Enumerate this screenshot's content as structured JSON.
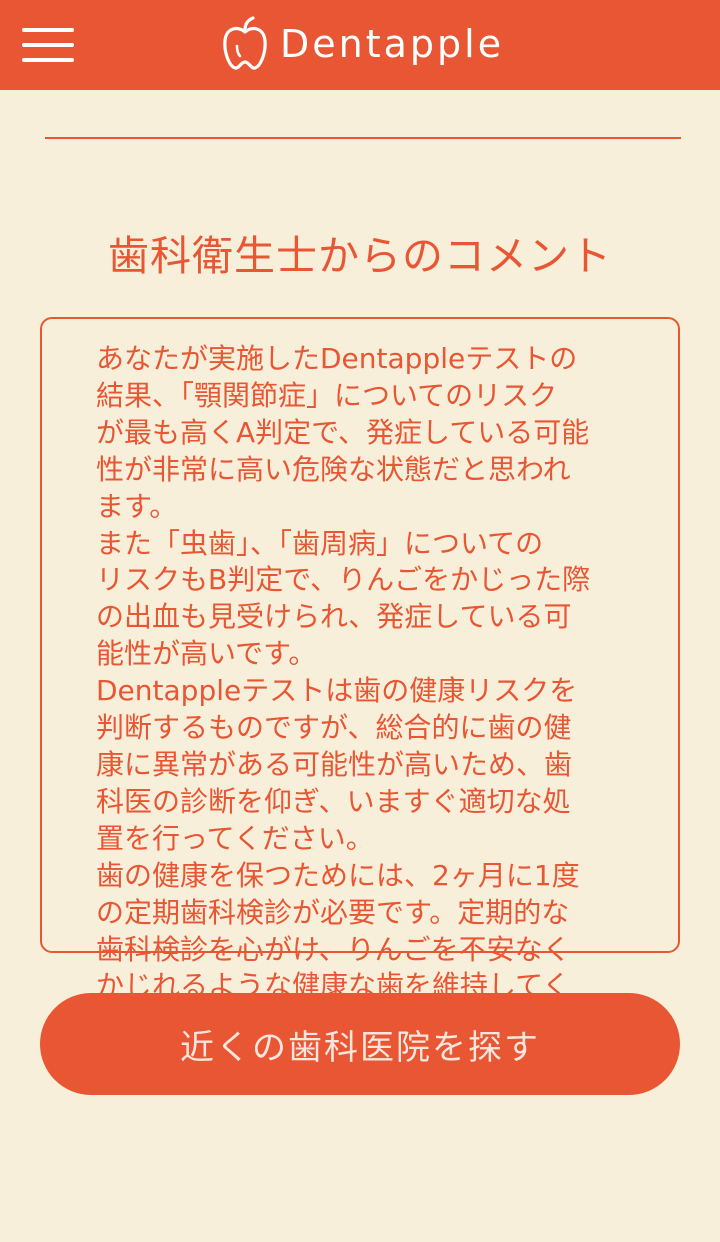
{
  "header": {
    "app_name": "Dentapple",
    "logo_icon": "apple-tooth-icon",
    "menu_icon": "hamburger-menu-icon",
    "background_color": "#e85634"
  },
  "main": {
    "section_title": "歯科衛生士からのコメント",
    "comment_text": "あなたが実施したDentappleテストの\n結果、「顎関節症」についてのリスク\nが最も高くA判定で、発症している可能\n性が非常に高い危険な状態だと思われ\nます。\nまた「虫歯」、「歯周病」についての\nリスクもB判定で、りんごをかじった際\nの出血も見受けられ、発症している可\n能性が高いです。\nDentappleテストは歯の健康リスクを\n判断するものですが、総合的に歯の健\n康に異常がある可能性が高いため、歯\n科医の診断を仰ぎ、いますぐ適切な処\n置を行ってください。\n歯の健康を保つためには、2ヶ月に1度\nの定期歯科検診が必要です。定期的な\n歯科検診を心がけ、りんごを不安なく\nかじれるような健康な歯を維持してく\nださい。",
    "cta_label": "近くの歯科医院を探す"
  },
  "colors": {
    "accent": "#e85634",
    "background": "#f7efd9",
    "button_text": "#fbe6dd"
  }
}
